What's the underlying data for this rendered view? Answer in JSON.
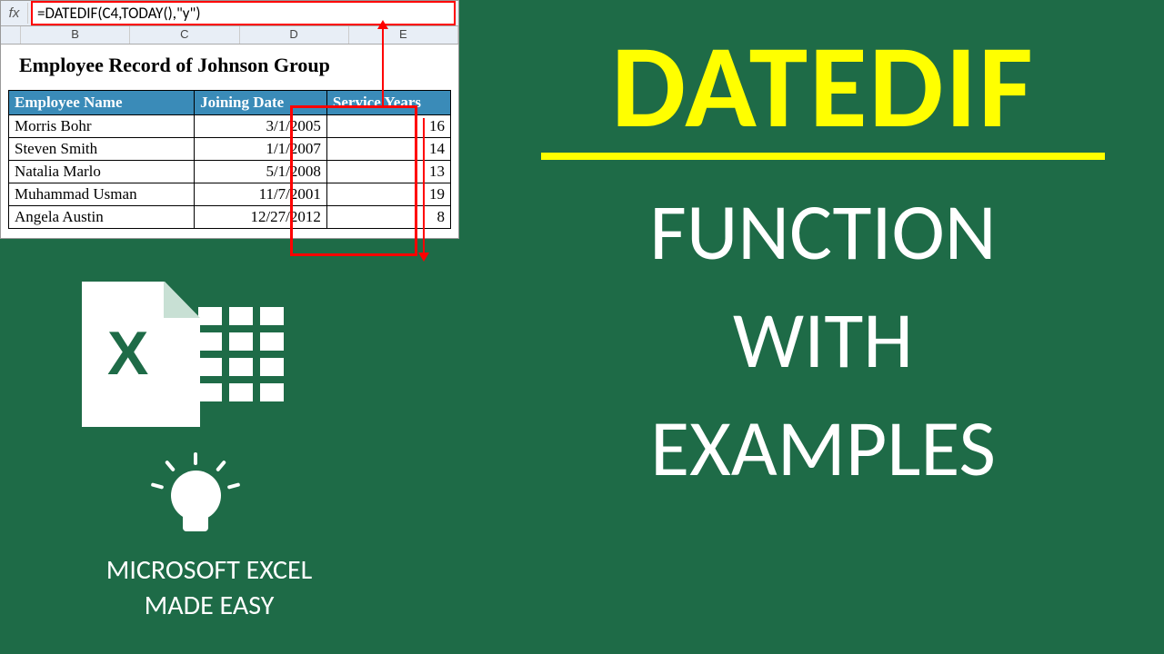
{
  "formula_bar": {
    "fx": "fx",
    "formula": "=DATEDIF(C4,TODAY(),\"y\")"
  },
  "columns": [
    "B",
    "C",
    "D",
    "E"
  ],
  "sheet": {
    "title": "Employee Record of Johnson Group",
    "headers": [
      "Employee Name",
      "Joining Date",
      "Service Years"
    ],
    "rows": [
      {
        "name": "Morris Bohr",
        "date": "3/1/2005",
        "years": "16"
      },
      {
        "name": "Steven Smith",
        "date": "1/1/2007",
        "years": "14"
      },
      {
        "name": "Natalia Marlo",
        "date": "5/1/2008",
        "years": "13"
      },
      {
        "name": "Muhammad Usman",
        "date": "11/7/2001",
        "years": "19"
      },
      {
        "name": "Angela Austin",
        "date": "12/27/2012",
        "years": "8"
      }
    ]
  },
  "excel_icon_letter": "X",
  "tagline_line1": "MICROSOFT EXCEL",
  "tagline_line2": "MADE EASY",
  "headline": "DATEDIF",
  "sub1": "FUNCTION",
  "sub2": "WITH",
  "sub3": "EXAMPLES"
}
